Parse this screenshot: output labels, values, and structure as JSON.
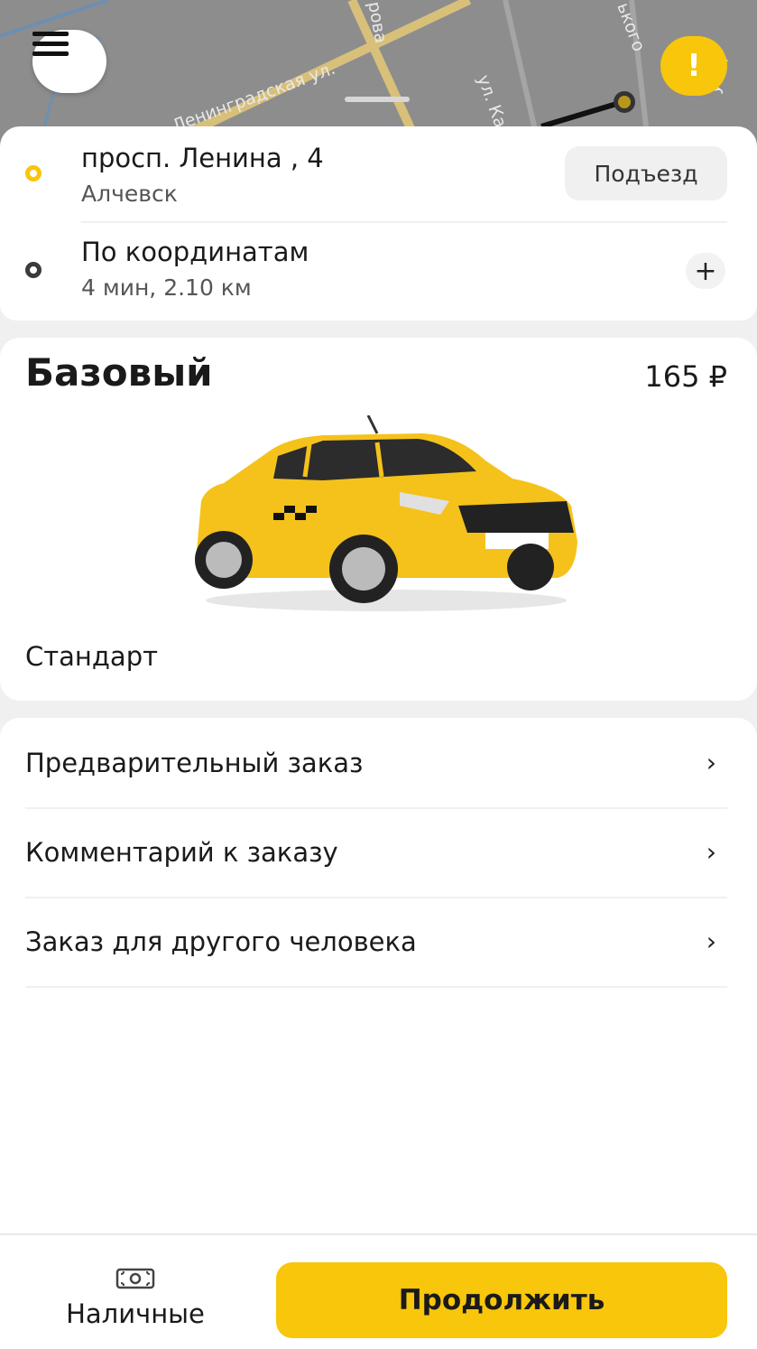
{
  "map": {
    "street_labels": [
      "Ленинградская ул.",
      "рова",
      "ул. Кали",
      "ького",
      "ул. Г"
    ],
    "menu_icon": "hamburger-menu-icon",
    "alert_icon": "exclamation-icon",
    "alert_symbol": "!"
  },
  "route": {
    "from": {
      "title": "просп. Ленина , 4",
      "subtitle": "Алчевск",
      "entrance_button": "Подъезд"
    },
    "to": {
      "title": "По координатам",
      "subtitle": "4 мин, 2.10 км",
      "add_symbol": "+"
    }
  },
  "tariff": {
    "name": "Базовый",
    "price": "165 ₽",
    "description": "Стандарт"
  },
  "options": [
    {
      "label": "Предварительный заказ",
      "chevron": "›"
    },
    {
      "label": "Комментарий к заказу",
      "chevron": "›"
    },
    {
      "label": "Заказ для другого человека",
      "chevron": "›"
    }
  ],
  "bottom": {
    "payment_label": "Наличные",
    "payment_icon": "cash-icon",
    "continue_label": "Продолжить"
  },
  "colors": {
    "accent": "#f8c60a",
    "background": "#f0f0f0"
  }
}
